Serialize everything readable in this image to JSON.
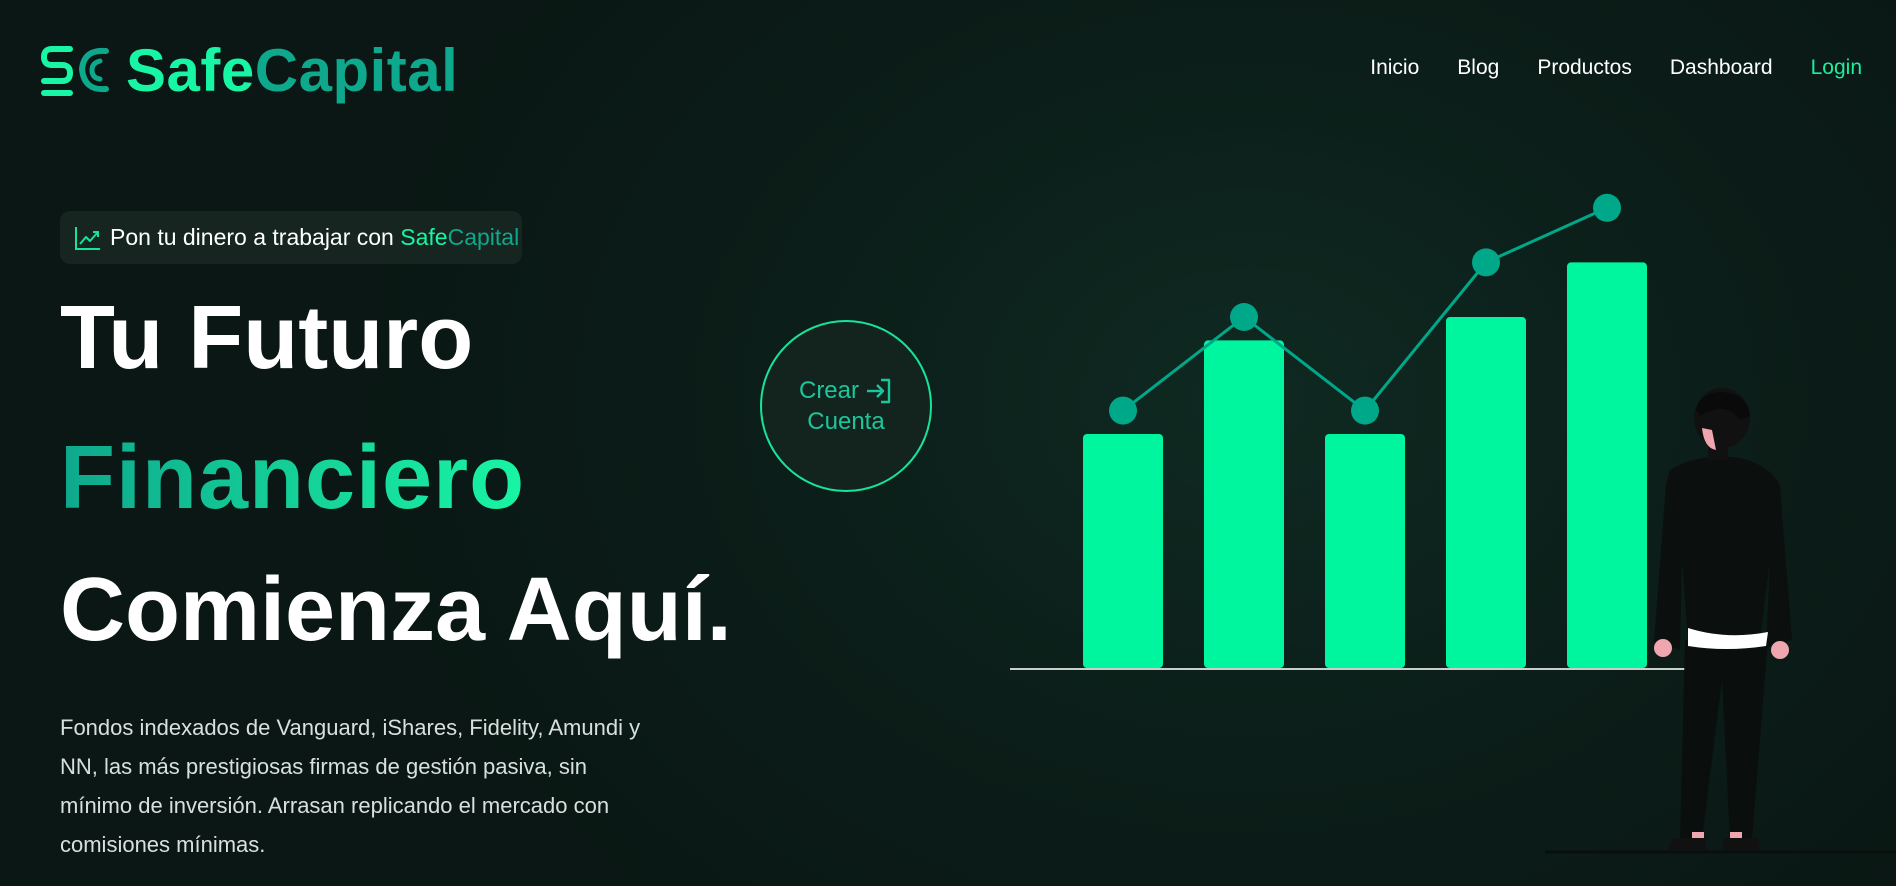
{
  "brand": {
    "name_part1": "Safe",
    "name_part2": "Capital",
    "color_primary": "#18f5a4",
    "color_secondary": "#0ea88c"
  },
  "nav": {
    "items": [
      {
        "label": "Inicio"
      },
      {
        "label": "Blog"
      },
      {
        "label": "Productos"
      },
      {
        "label": "Dashboard"
      },
      {
        "label": "Login",
        "highlight": true
      }
    ]
  },
  "hero": {
    "badge": {
      "icon": "trending-up-icon",
      "text": "Pon tu dinero a trabajar con ",
      "brand_part1": "Safe",
      "brand_part2": "Capital"
    },
    "headline_line1": "Tu Futuro",
    "headline_line2": "Financiero",
    "headline_line3": "Comienza Aquí.",
    "description": "Fondos indexados de Vanguard, iShares, Fidelity, Amundi y NN, las más prestigiosas firmas de gestión pasiva, sin mínimo de inversión. Arrasan replicando el mercado con comisiones mínimas."
  },
  "cta": {
    "line1": "Crear",
    "line2": "Cuenta",
    "icon": "login-arrow-icon"
  },
  "illustration": {
    "bar_color": "#00f59f",
    "point_color": "#00a88a",
    "bar_values": [
      3,
      4.2,
      3,
      4.5,
      5.2
    ],
    "trend_values": [
      3.3,
      4.5,
      3.3,
      5.2,
      5.9
    ]
  }
}
